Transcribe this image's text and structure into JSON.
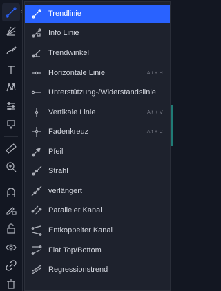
{
  "menu": {
    "items": [
      {
        "label": "Trendlinie",
        "shortcut": "",
        "icon": "trendline-icon"
      },
      {
        "label": "Info Linie",
        "shortcut": "",
        "icon": "info-line-icon"
      },
      {
        "label": "Trendwinkel",
        "shortcut": "",
        "icon": "trend-angle-icon"
      },
      {
        "label": "Horizontale Linie",
        "shortcut": "Alt + H",
        "icon": "horizontal-line-icon"
      },
      {
        "label": "Unterstützung-/Widerstandslinie",
        "shortcut": "",
        "icon": "support-resistance-line-icon"
      },
      {
        "label": "Vertikale Linie",
        "shortcut": "Alt + V",
        "icon": "vertical-line-icon"
      },
      {
        "label": "Fadenkreuz",
        "shortcut": "Alt + C",
        "icon": "crosshair-icon"
      },
      {
        "label": "Pfeil",
        "shortcut": "",
        "icon": "arrow-icon"
      },
      {
        "label": "Strahl",
        "shortcut": "",
        "icon": "ray-icon"
      },
      {
        "label": "verlängert",
        "shortcut": "",
        "icon": "extended-line-icon"
      },
      {
        "label": "Paralleler Kanal",
        "shortcut": "",
        "icon": "parallel-channel-icon"
      },
      {
        "label": "Entkoppelter Kanal",
        "shortcut": "",
        "icon": "disjoint-channel-icon"
      },
      {
        "label": "Flat Top/Bottom",
        "shortcut": "",
        "icon": "flat-top-bottom-icon"
      },
      {
        "label": "Regressionstrend",
        "shortcut": "",
        "icon": "regression-trend-icon"
      }
    ]
  },
  "colors": {
    "accent": "#2962ff",
    "background": "#131722",
    "menu_background": "#1e222d",
    "text": "#d1d4dc",
    "muted": "#787b86"
  }
}
